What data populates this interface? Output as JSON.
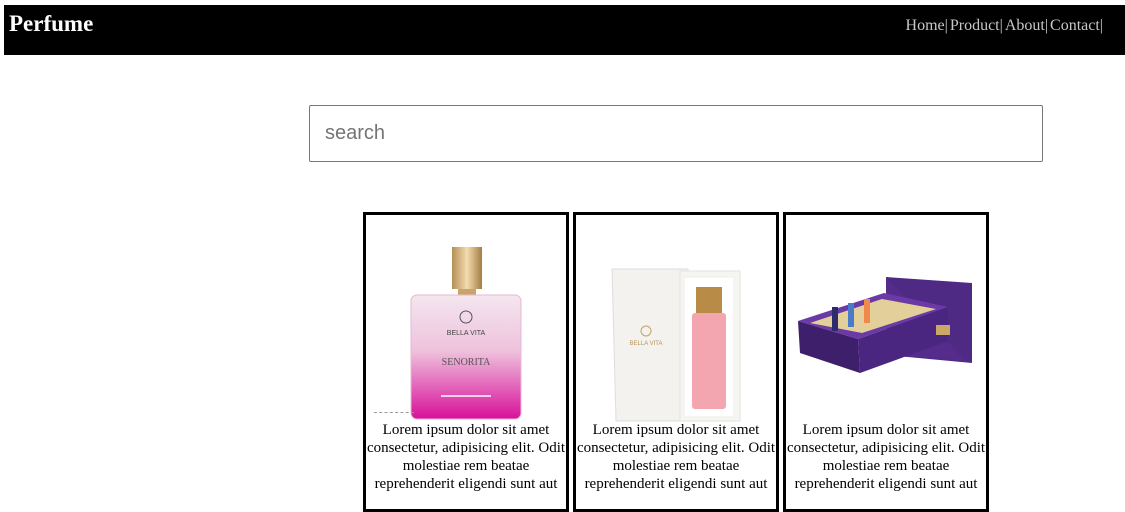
{
  "header": {
    "brand": "Perfume",
    "nav": [
      {
        "label": "Home"
      },
      {
        "label": "Product"
      },
      {
        "label": "About"
      },
      {
        "label": "Contact"
      }
    ],
    "separator": "|"
  },
  "search": {
    "placeholder": "search",
    "value": ""
  },
  "products": [
    {
      "image": "pink-perfume-bottle",
      "brand_text": "BELLA VITA",
      "name": "SENORITA",
      "description": "Lorem ipsum dolor sit amet consectetur, adipisicing elit. Odit molestiae rem beatae reprehenderit eligendi sunt aut"
    },
    {
      "image": "perfume-box-with-pink-bottle",
      "brand_text": "BELLA VITA",
      "description": "Lorem ipsum dolor sit amet consectetur, adipisicing elit. Odit molestiae rem beatae reprehenderit eligendi sunt aut"
    },
    {
      "image": "purple-gift-set",
      "description": "Lorem ipsum dolor sit amet consectetur, adipisicing elit. Odit molestiae rem beatae reprehenderit eligendi sunt aut"
    }
  ],
  "colors": {
    "navbar": "#000000",
    "nav_link": "#c8c8c8",
    "card_border": "#000000",
    "pink": "#e0109a",
    "purple": "#5a2d91"
  }
}
